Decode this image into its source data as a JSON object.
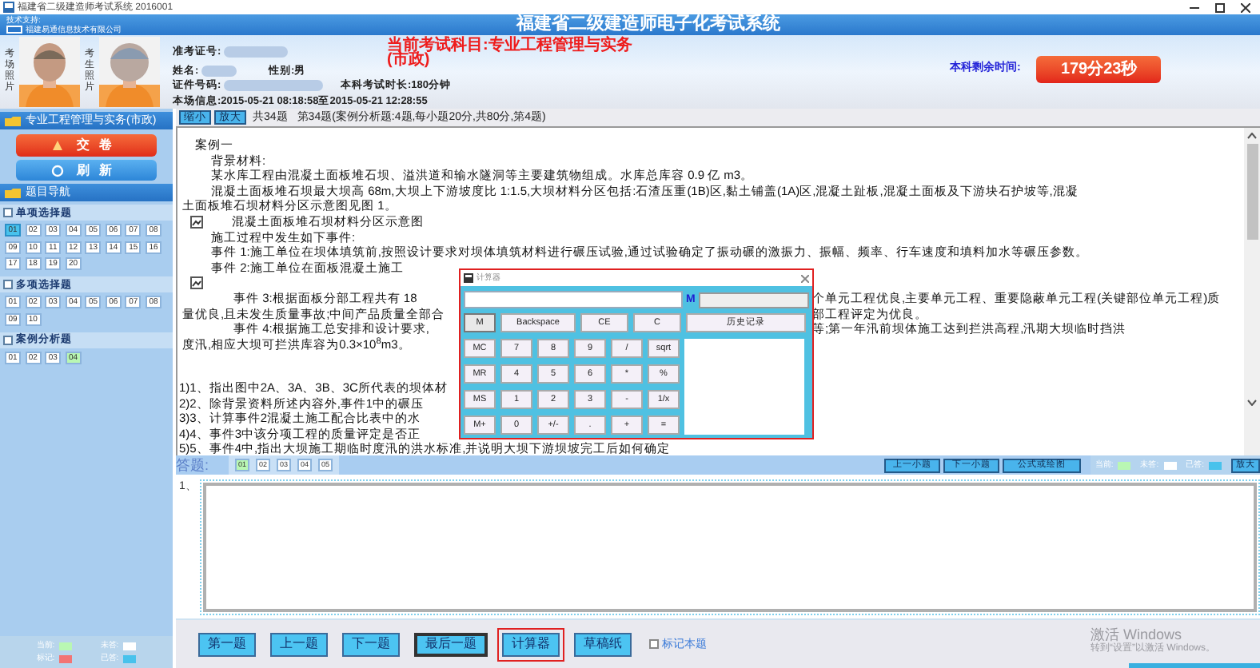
{
  "window": {
    "title": "福建省二级建造师考试系统 2016001"
  },
  "header": {
    "support_label": "技术支持:",
    "company": "福建易通信息技术有限公司",
    "system_title": "福建省二级建造师电子化考试系统",
    "photos": [
      {
        "label": "考场照片"
      },
      {
        "label": "考生照片"
      }
    ],
    "info": [
      {
        "label": "准考证号:",
        "redacted": true
      },
      {
        "label": "姓名:",
        "redacted": true
      },
      {
        "label": "性别:男"
      },
      {
        "label": "证件号码:",
        "redacted": true
      },
      {
        "label": "本科考试时长:180分钟"
      },
      {
        "label": "本场信息:2015-05-21 08:18:58至2015-05-21 12:28:55"
      }
    ],
    "subject": "当前考试科目:专业工程管理与实务(市政)",
    "timer_label": "本科剩余时间:",
    "timer": "179分23秒"
  },
  "sidebar": {
    "subject": "专业工程管理与实务(市政)",
    "submit": "交卷",
    "refresh": "刷新",
    "nav_title": "题目导航",
    "sections": [
      {
        "title": "单项选择题",
        "items": [
          {
            "label": "01",
            "current": false,
            "answered": true
          },
          {
            "label": "02",
            "current": false,
            "answered": false
          },
          {
            "label": "03",
            "current": false,
            "answered": false
          },
          {
            "label": "04",
            "current": false,
            "answered": false
          },
          {
            "label": "05",
            "current": false,
            "answered": false
          },
          {
            "label": "06",
            "current": false,
            "answered": false
          },
          {
            "label": "07",
            "current": false,
            "answered": false
          },
          {
            "label": "08",
            "current": false,
            "answered": false
          },
          {
            "label": "09",
            "current": false,
            "answered": false
          },
          {
            "label": "10",
            "current": false,
            "answered": false
          },
          {
            "label": "11",
            "current": false,
            "answered": false
          },
          {
            "label": "12",
            "current": false,
            "answered": false
          },
          {
            "label": "13",
            "current": false,
            "answered": false
          },
          {
            "label": "14",
            "current": false,
            "answered": false
          },
          {
            "label": "15",
            "current": false,
            "answered": false
          },
          {
            "label": "16",
            "current": false,
            "answered": false
          },
          {
            "label": "17",
            "current": false,
            "answered": false
          },
          {
            "label": "18",
            "current": false,
            "answered": false
          },
          {
            "label": "19",
            "current": false,
            "answered": false
          },
          {
            "label": "20",
            "current": false,
            "answered": false
          }
        ]
      },
      {
        "title": "多项选择题",
        "items": [
          {
            "label": "01",
            "current": false,
            "answered": false
          },
          {
            "label": "02",
            "current": false,
            "answered": false
          },
          {
            "label": "03",
            "current": false,
            "answered": false
          },
          {
            "label": "04",
            "current": false,
            "answered": false
          },
          {
            "label": "05",
            "current": false,
            "answered": false
          },
          {
            "label": "06",
            "current": false,
            "answered": false
          },
          {
            "label": "07",
            "current": false,
            "answered": false
          },
          {
            "label": "08",
            "current": false,
            "answered": false
          },
          {
            "label": "09",
            "current": false,
            "answered": false
          },
          {
            "label": "10",
            "current": false,
            "answered": false
          }
        ]
      },
      {
        "title": "案例分析题",
        "items": [
          {
            "label": "01",
            "current": false,
            "answered": false
          },
          {
            "label": "02",
            "current": false,
            "answered": false
          },
          {
            "label": "03",
            "current": false,
            "answered": false
          },
          {
            "label": "04",
            "current": true,
            "answered": false
          }
        ]
      }
    ],
    "legend": [
      {
        "label": "当前:",
        "color": "#b9f7b3"
      },
      {
        "label": "未答:",
        "color": "#ffffff"
      },
      {
        "label": "标记:",
        "color": "#f27474"
      },
      {
        "label": "已答:",
        "color": "#48c2ec"
      }
    ]
  },
  "toolbar": {
    "buttons": [
      "缩小",
      "放大"
    ],
    "count": "共34题",
    "position": "第34题(案例分析题:4题,每小题20分,共80分,第4题)"
  },
  "question": {
    "lines": [
      {
        "kind": "title",
        "text": "案例一"
      },
      {
        "kind": "body",
        "text": "背景材料:"
      },
      {
        "kind": "body",
        "text": "某水库工程由混凝土面板堆石坝、溢洪道和输水隧洞等主要建筑物组成。水库总库容 0.9 亿 m3。"
      },
      {
        "kind": "body",
        "text": "混凝土面板堆石坝最大坝高 68m,大坝上下游坡度比 1:1.5,大坝材料分区包括:石渣压重(1B)区,黏土铺盖(1A)区,混凝土趾板,混凝土面板及下游块石护坡等,混凝"
      },
      {
        "kind": "continuation",
        "text": "土面板堆石坝材料分区示意图见图 1。"
      },
      {
        "kind": "figure",
        "caption": "混凝土面板堆石坝材料分区示意图"
      },
      {
        "kind": "body",
        "text": "施工过程中发生如下事件:"
      },
      {
        "kind": "body",
        "text": "事件 1:施工单位在坝体填筑前,按照设计要求对坝体填筑材料进行碾压试验,通过试验确定了振动碾的激振力、振幅、频率、行车速度和填料加水等碾压参数。"
      },
      {
        "kind": "body",
        "text": "事件 2:施工单位在面板混凝土施工"
      },
      {
        "kind": "figure"
      },
      {
        "kind": "indented",
        "text": "事件 3:根据面板分部工程共有 18",
        "right": "个单元工程优良,主要单元工程、重要隐蔽单元工程(关键部位单元工程)质"
      },
      {
        "kind": "continuation",
        "text": "量优良,且未发生质量事故;中间产品质量全部合",
        "right": "部工程评定为优良。"
      },
      {
        "kind": "indented",
        "text": "事件 4:根据施工总安排和设计要求,",
        "right": "等;第一年汛前坝体施工达到拦洪高程,汛期大坝临时挡洪"
      },
      {
        "kind": "continuation",
        "text": "度汛,相应大坝可拦洪库容为0.3×10$^{8}$m3。"
      }
    ],
    "questions": [
      {
        "text": "1)1、指出图中2A、3A、3B、3C所代表的坝体材"
      },
      {
        "text": "2)2、除背景资料所述内容外,事件1中的碾压"
      },
      {
        "text": "3)3、计算事件2混凝土施工配合比表中的水"
      },
      {
        "text": "4)4、事件3中该分项工程的质量评定是否正"
      },
      {
        "text": "5)5、事件4中,指出大坝施工期临时度汛的洪水标准,并说明大坝下游坝坡完工后如何确定"
      }
    ]
  },
  "calculator": {
    "title": "计算器",
    "memory_label": "M",
    "top_keys": [
      {
        "label": "M",
        "kind": "indicator"
      },
      {
        "label": "Backspace",
        "kind": "wide"
      },
      {
        "label": "CE",
        "kind": "key"
      },
      {
        "label": "C",
        "kind": "key"
      },
      {
        "label": "历史记录",
        "kind": "history"
      }
    ],
    "keys": [
      [
        "MC",
        "7",
        "8",
        "9",
        "/",
        "sqrt"
      ],
      [
        "MR",
        "4",
        "5",
        "6",
        "*",
        "%"
      ],
      [
        "MS",
        "1",
        "2",
        "3",
        "-",
        "1/x"
      ],
      [
        "M+",
        "0",
        "+/-",
        ".",
        "+",
        "="
      ]
    ]
  },
  "answer_bar": {
    "label": "答题:",
    "tabs": [
      {
        "label": "01",
        "current": true
      },
      {
        "label": "02",
        "current": false
      },
      {
        "label": "03",
        "current": false
      },
      {
        "label": "04",
        "current": false
      },
      {
        "label": "05",
        "current": false
      }
    ],
    "buttons": [
      "上一小题",
      "下一小题",
      "公式或绘图"
    ],
    "legend": [
      {
        "label": "当前:",
        "color": "#b9f7b3"
      },
      {
        "label": "未答:",
        "color": "#ffffff"
      },
      {
        "label": "已答:",
        "color": "#48c2ec"
      }
    ],
    "zoom": "放大"
  },
  "answer": {
    "number": "1、"
  },
  "bottom": {
    "buttons": [
      {
        "label": "第一题",
        "kind": "normal"
      },
      {
        "label": "上一题",
        "kind": "normal"
      },
      {
        "label": "下一题",
        "kind": "normal"
      },
      {
        "label": "最后一题",
        "kind": "focused"
      },
      {
        "label": "计算器",
        "kind": "highlighted"
      },
      {
        "label": "草稿纸",
        "kind": "normal"
      }
    ],
    "mark": {
      "label": "标记本题",
      "checked": false
    }
  },
  "os_notice": {
    "title": "激活 Windows",
    "text": "转到“设置”以激活 Windows。"
  }
}
